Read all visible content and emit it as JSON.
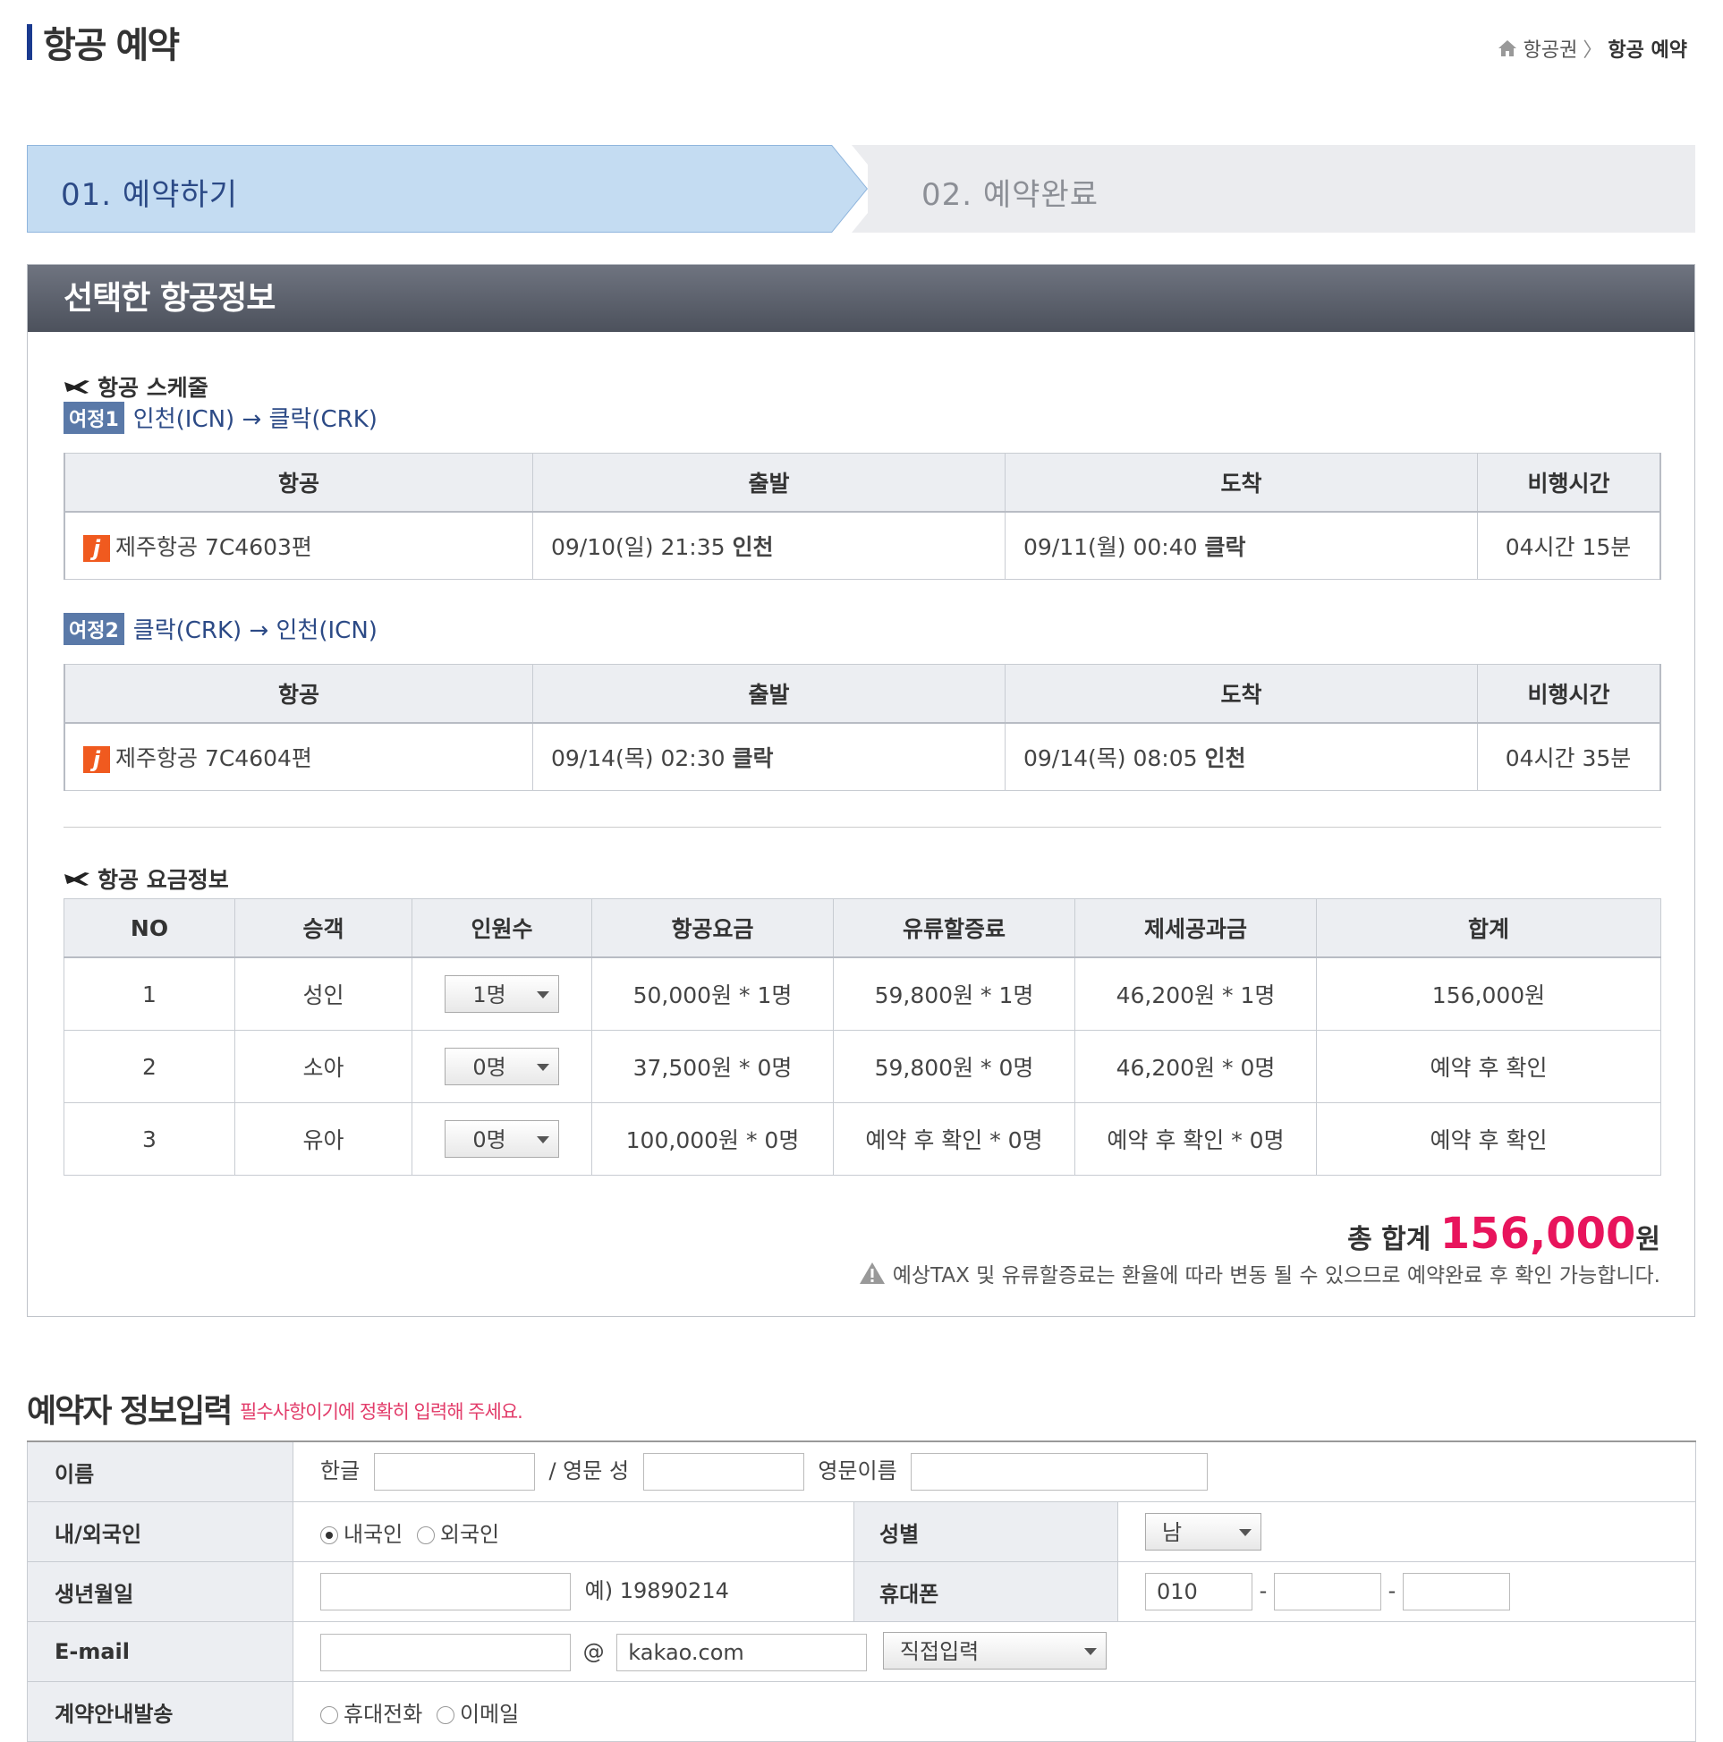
{
  "header": {
    "title": "항공 예약",
    "breadcrumb": {
      "parent": "항공권",
      "current": "항공 예약"
    }
  },
  "steps": [
    {
      "label": "01. 예약하기",
      "active": true
    },
    {
      "label": "02. 예약완료",
      "active": false
    }
  ],
  "info": {
    "heading": "선택한 항공정보",
    "schedule_title": "항공 스케줄",
    "columns": [
      "항공",
      "출발",
      "도착",
      "비행시간"
    ],
    "legs": [
      {
        "badge": "여정1",
        "route": "인천(ICN) → 클락(CRK)",
        "airline": "제주항공 7C4603편",
        "dep_time": "09/10(일) 21:35",
        "dep_city": "인천",
        "arr_time": "09/11(월) 00:40",
        "arr_city": "클락",
        "duration": "04시간 15분"
      },
      {
        "badge": "여정2",
        "route": "클락(CRK) → 인천(ICN)",
        "airline": "제주항공 7C4604편",
        "dep_time": "09/14(목) 02:30",
        "dep_city": "클락",
        "arr_time": "09/14(목) 08:05",
        "arr_city": "인천",
        "duration": "04시간 35분"
      }
    ],
    "fare_title": "항공 요금정보",
    "fare_columns": [
      "NO",
      "승객",
      "인원수",
      "항공요금",
      "유류할증료",
      "제세공과금",
      "합계"
    ],
    "fares": [
      {
        "no": "1",
        "type": "성인",
        "count": "1명",
        "fare": "50,000원 * 1명",
        "fuel": "59,800원 * 1명",
        "tax": "46,200원 * 1명",
        "sum": "156,000원"
      },
      {
        "no": "2",
        "type": "소아",
        "count": "0명",
        "fare": "37,500원 * 0명",
        "fuel": "59,800원 * 0명",
        "tax": "46,200원 * 0명",
        "sum": "예약 후 확인"
      },
      {
        "no": "3",
        "type": "유아",
        "count": "0명",
        "fare": "100,000원 * 0명",
        "fuel": "예약 후 확인 * 0명",
        "tax": "예약 후 확인 * 0명",
        "sum": "예약 후 확인"
      }
    ],
    "total_label": "총 합계",
    "total_amount": "156,000",
    "total_unit": "원",
    "notice": "예상TAX 및 유류할증료는 환율에 따라 변동 될 수 있으므로 예약완료 후 확인 가능합니다."
  },
  "booker": {
    "title": "예약자 정보입력",
    "subtitle": "필수사항이기에 정확히 입력해 주세요.",
    "name_label": "이름",
    "korean_label": "한글",
    "eng_last_label": "/ 영문 성",
    "eng_first_label": "영문이름",
    "nationality_label": "내/외국인",
    "domestic": "내국인",
    "foreign": "외국인",
    "gender_label": "성별",
    "gender_value": "남",
    "birth_label": "생년월일",
    "birth_hint": "예) 19890214",
    "phone_label": "휴대폰",
    "phone_prefix": "010",
    "email_label": "E-mail",
    "email_at": "@",
    "email_domain": "kakao.com",
    "email_select": "직접입력",
    "notify_label": "계약안내발송",
    "notify_phone": "휴대전화",
    "notify_email": "이메일"
  }
}
